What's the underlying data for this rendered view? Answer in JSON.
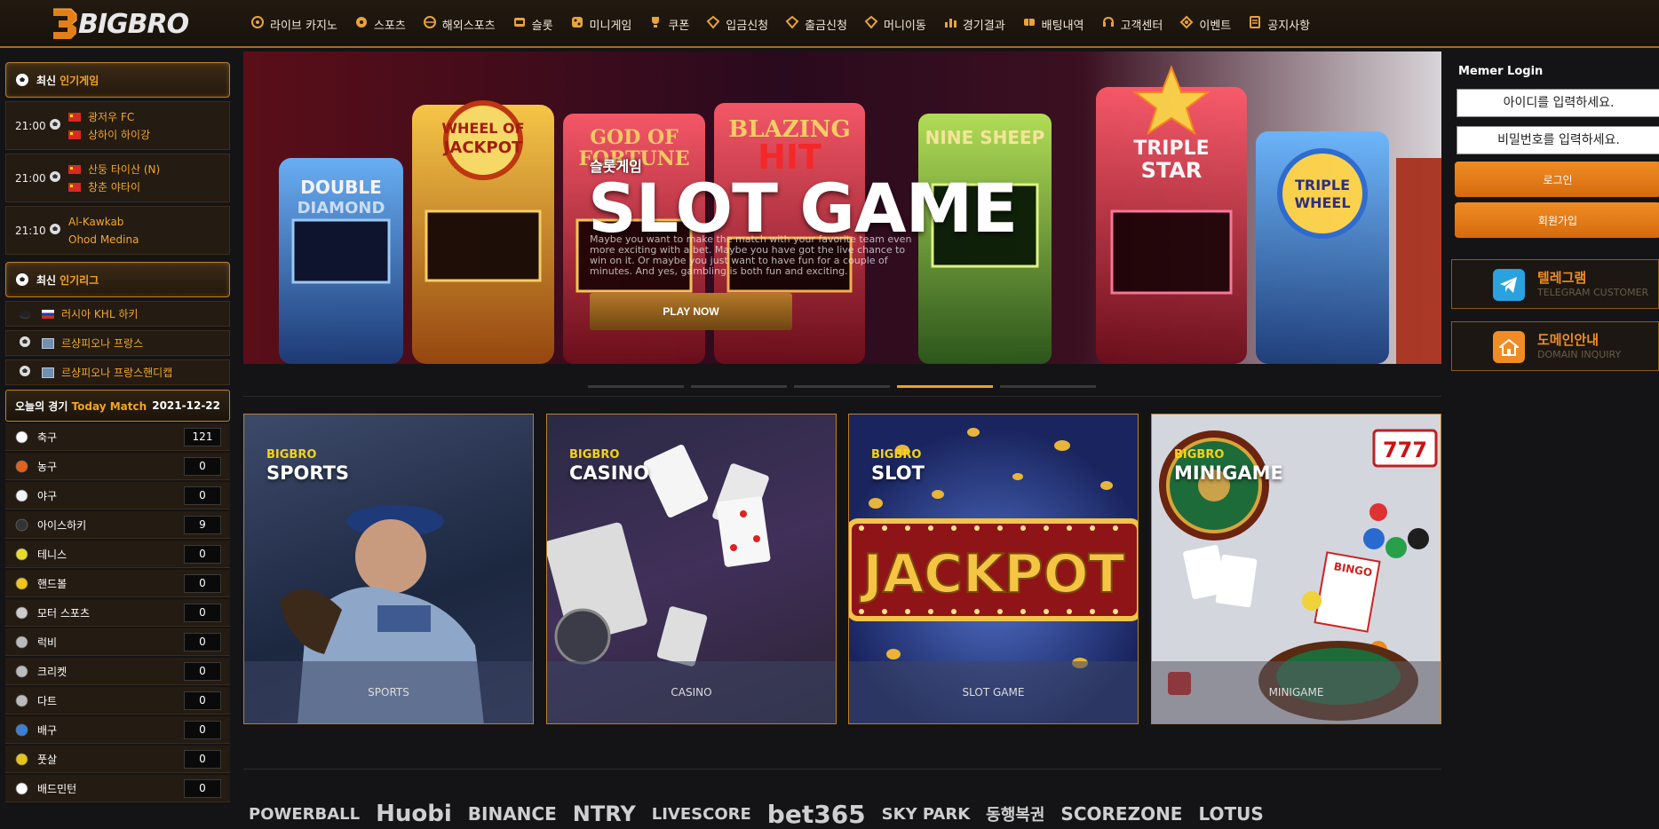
{
  "header": {
    "logo_text": "BIGBRO",
    "nav": [
      {
        "label": "라이브 카지노",
        "icon": "casino-chip-icon"
      },
      {
        "label": "스포츠",
        "icon": "soccer-icon"
      },
      {
        "label": "해외스포츠",
        "icon": "globe-icon"
      },
      {
        "label": "슬롯",
        "icon": "slot-icon"
      },
      {
        "label": "미니게임",
        "icon": "dice-icon"
      },
      {
        "label": "쿠폰",
        "icon": "trophy-icon"
      },
      {
        "label": "입금신청",
        "icon": "diamond-icon"
      },
      {
        "label": "출금신청",
        "icon": "diamond-icon"
      },
      {
        "label": "머니이동",
        "icon": "diamond-icon"
      },
      {
        "label": "경기결과",
        "icon": "chart-icon"
      },
      {
        "label": "배팅내역",
        "icon": "ticket-icon"
      },
      {
        "label": "고객센터",
        "icon": "headset-icon"
      },
      {
        "label": "이벤트",
        "icon": "gift-icon"
      },
      {
        "label": "공지사항",
        "icon": "notice-icon"
      }
    ]
  },
  "sidebar": {
    "popular_games_title": "최신",
    "popular_games_hl": "인기게임",
    "matches": [
      {
        "time": "21:00",
        "home": "광저우 FC",
        "away": "상하이 하이강",
        "flags": true
      },
      {
        "time": "21:00",
        "home": "산둥 타이산 (N)",
        "away": "창춘 야타이",
        "flags": true
      },
      {
        "time": "21:10",
        "home": "Al-Kawkab",
        "away": "Ohod Medina",
        "flags": false
      }
    ],
    "popular_leagues_title": "최신",
    "popular_leagues_hl": "인기리그",
    "leagues": [
      {
        "name": "러시아 KHL 하키",
        "flag": "ru"
      },
      {
        "name": "르샹피오나 프랑스",
        "flag": "fr"
      },
      {
        "name": "르샹피오나 프랑스핸디캡",
        "flag": "fr"
      }
    ],
    "today_title": "오늘의 경기",
    "today_hl": "Today Match",
    "today_date": "2021-12-22",
    "sports": [
      {
        "name": "축구",
        "count": "121",
        "icon": "soccer-ball-icon",
        "color": "#ffffff"
      },
      {
        "name": "농구",
        "count": "0",
        "icon": "basketball-icon",
        "color": "#e0621d"
      },
      {
        "name": "야구",
        "count": "0",
        "icon": "baseball-icon",
        "color": "#f3f3f3"
      },
      {
        "name": "아이스하키",
        "count": "9",
        "icon": "hockey-puck-icon",
        "color": "#333333"
      },
      {
        "name": "테니스",
        "count": "0",
        "icon": "tennis-ball-icon",
        "color": "#e8dc2a"
      },
      {
        "name": "핸드볼",
        "count": "0",
        "icon": "handball-icon",
        "color": "#f0c419"
      },
      {
        "name": "모터 스포츠",
        "count": "0",
        "icon": "checkered-flag-icon",
        "color": "#cccccc"
      },
      {
        "name": "럭비",
        "count": "0",
        "icon": "rugby-ball-icon",
        "color": "#bbbbbb"
      },
      {
        "name": "크리켓",
        "count": "0",
        "icon": "cricket-icon",
        "color": "#bbbbbb"
      },
      {
        "name": "다트",
        "count": "0",
        "icon": "dart-board-icon",
        "color": "#bbbbbb"
      },
      {
        "name": "배구",
        "count": "0",
        "icon": "volleyball-icon",
        "color": "#3a7fd5"
      },
      {
        "name": "풋살",
        "count": "0",
        "icon": "futsal-ball-icon",
        "color": "#e8c21a"
      },
      {
        "name": "배드민턴",
        "count": "0",
        "icon": "shuttlecock-icon",
        "color": "#ffffff"
      }
    ]
  },
  "banner": {
    "subtitle": "슬롯게임",
    "title": "SLOT GAME",
    "description": "Maybe you want to make the match with your favorite team even more exciting with a bet. Maybe you have got the live chance to win on it. Or maybe you just want to have fun for a couple of minutes. And yes, gambling is both fun and exciting.",
    "play_label": "PLAY NOW",
    "slides": 5,
    "active_slide": 4
  },
  "cards": [
    {
      "brand": "BIGBRO",
      "name": "SPORTS",
      "footer": "SPORTS"
    },
    {
      "brand": "BIGBRO",
      "name": "CASINO",
      "footer": "CASINO"
    },
    {
      "brand": "BIGBRO",
      "name": "SLOT",
      "footer": "SLOT GAME"
    },
    {
      "brand": "BIGBRO",
      "name": "MINIGAME",
      "footer": "MINIGAME"
    }
  ],
  "partners": [
    "POWERBALL",
    "Huobi",
    "BINANCE",
    "NTRY",
    "LIVESCORE",
    "bet365",
    "SKY PARK",
    "동행복권",
    "SCOREZONE",
    "LOTUS"
  ],
  "login": {
    "title": "Memer Login",
    "id_placeholder": "아이디를 입력하세요.",
    "pw_placeholder": "비밀번호를 입력하세요.",
    "login_label": "로그인",
    "join_label": "회원가입"
  },
  "telegram": {
    "main": "텔레그램",
    "sub": "TELEGRAM CUSTOMER"
  },
  "domain": {
    "main": "도메인안내",
    "sub": "DOMAIN INQUIRY"
  },
  "colors": {
    "accent": "#f4a51c",
    "orange_button": "#e57b18",
    "brand_yellow": "#f4d21a"
  }
}
